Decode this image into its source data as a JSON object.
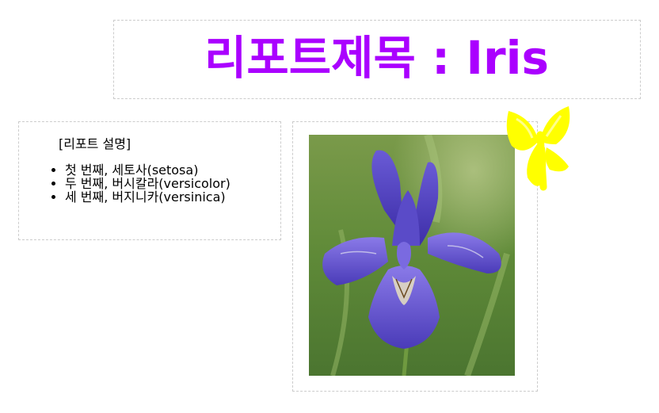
{
  "report": {
    "title": "리포트제목 : Iris",
    "title_color": "#aa00ff",
    "description_heading": "[리포트 설명]",
    "items": [
      "첫 번째, 세토사(setosa)",
      "두 번째, 버시칼라(versicolor)",
      "세 번째, 버지니카(versinica)"
    ]
  },
  "image": {
    "subject": "iris-flower-photo"
  },
  "sticker": {
    "subject": "yellow-butterfly-doodle",
    "color": "#ffff00"
  }
}
